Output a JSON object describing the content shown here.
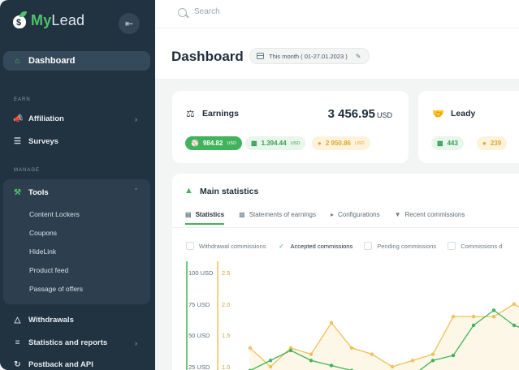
{
  "brand": {
    "my": "My",
    "lead": "Lead"
  },
  "search": {
    "placeholder": "Search"
  },
  "sidebar": {
    "dashboard": "Dashboard",
    "earn_label": "EARN",
    "affiliation": "Affiliation",
    "surveys": "Surveys",
    "manage_label": "MANAGE",
    "tools": "Tools",
    "tools_items": [
      "Content Lockers",
      "Coupons",
      "HideLink",
      "Product feed",
      "Passage of offers"
    ],
    "withdrawals": "Withdrawals",
    "stats_reports": "Statistics and reports",
    "postback": "Postback and API"
  },
  "header": {
    "title": "Dashboard",
    "date_range": "This month  ( 01-27.01.2023 )"
  },
  "earnings": {
    "title": "Earnings",
    "total": "3 456.95",
    "currency": "USD",
    "pills": [
      {
        "value": "984.82",
        "cur": "USD"
      },
      {
        "value": "1.394.44",
        "cur": "USD"
      },
      {
        "value": "2 950.86",
        "cur": "USD"
      }
    ]
  },
  "leady": {
    "title": "Leady",
    "pills": [
      "443",
      "239"
    ]
  },
  "stats": {
    "title": "Main statistics",
    "tabs": [
      "Statistics",
      "Statements of earnings",
      "Configurations",
      "Recent commissions"
    ],
    "checks": [
      "Withdrawal commissions",
      "Accepted commissions",
      "Pending commissions",
      "Commissions d"
    ]
  },
  "colors": {
    "accent": "#41b35c",
    "sidebar": "#213241",
    "yellow": "#f0c05a"
  },
  "chart_data": {
    "type": "line",
    "y_left_ticks": [
      "100 USD",
      "75 USD",
      "50 USD",
      "25 USD"
    ],
    "y_right_ticks": [
      "2.5",
      "2.0",
      "1.5",
      "1.0"
    ],
    "series": [
      {
        "color": "#f0c05a",
        "values": [
          1.3,
          1.0,
          1.3,
          1.2,
          1.7,
          1.3,
          1.2,
          1.0,
          1.1,
          1.2,
          1.8,
          1.8,
          1.8,
          2.0,
          1.8,
          2.0,
          1.9
        ]
      },
      {
        "color": "#41b35c",
        "values": [
          22,
          30,
          38,
          30,
          26,
          22,
          20,
          20,
          18,
          30,
          34,
          58,
          70,
          58,
          52,
          55,
          62
        ]
      }
    ]
  }
}
